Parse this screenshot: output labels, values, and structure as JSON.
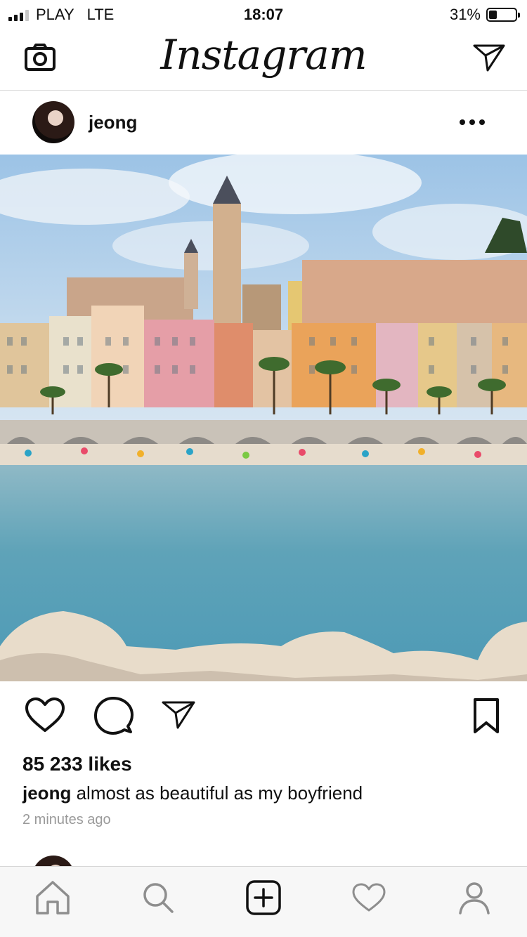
{
  "status_bar": {
    "carrier": "PLAY",
    "network": "LTE",
    "time": "18:07",
    "battery_percent": "31%",
    "battery_level": 0.31
  },
  "top_nav": {
    "brand": "Instagram",
    "icons": [
      "camera-icon",
      "direct-message-icon"
    ]
  },
  "post": {
    "username": "jeong",
    "likes": "85 233 likes",
    "caption_user": "jeong",
    "caption_text": "almost as beautiful as my boyfriend",
    "time_ago": "2 minutes ago"
  },
  "actions": [
    "heart-icon",
    "comment-icon",
    "share-icon",
    "bookmark-icon"
  ],
  "tab_bar": [
    "home-icon",
    "search-icon",
    "add-post-icon",
    "activity-icon",
    "profile-icon"
  ],
  "colors": {
    "text": "#111111",
    "muted": "#9a9a9a",
    "divider": "#dbdbdb",
    "tabbar_bg": "#f7f7f7",
    "tab_icon": "#8e8e8e"
  }
}
